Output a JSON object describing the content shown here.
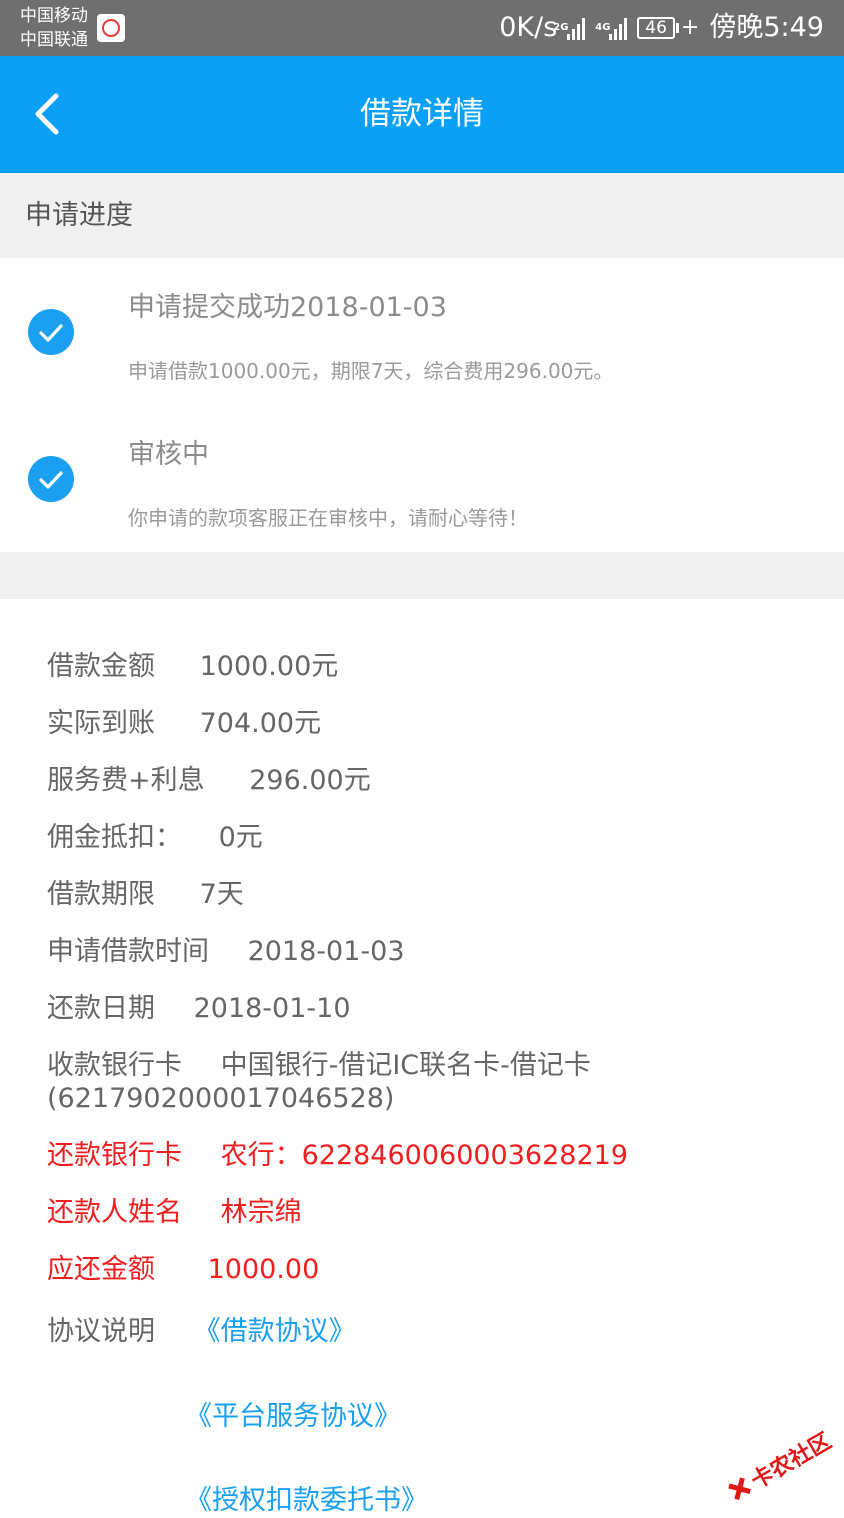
{
  "status_bar": {
    "carrier1": "中国移动",
    "carrier2": "中国联通",
    "speed": "0K/s",
    "net1": "2G",
    "net2": "4G",
    "battery": "46",
    "time": "傍晚5:49"
  },
  "header": {
    "title": "借款详情",
    "back_icon": "chevron-left-icon"
  },
  "progress": {
    "section_title": "申请进度",
    "steps": [
      {
        "title": "申请提交成功2018-01-03",
        "desc": "申请借款1000.00元，期限7天，综合费用296.00元。"
      },
      {
        "title": "审核中",
        "desc": "你申请的款项客服正在审核中，请耐心等待！"
      }
    ]
  },
  "details": {
    "loan_amount": {
      "label": "借款金额",
      "value": "1000.00元"
    },
    "actual_received": {
      "label": "实际到账",
      "value": "704.00元"
    },
    "fee_interest": {
      "label": "服务费+利息",
      "value": "296.00元"
    },
    "commission": {
      "label": "佣金抵扣：",
      "value": "0元"
    },
    "term": {
      "label": "借款期限",
      "value": "7天"
    },
    "apply_time": {
      "label": "申请借款时间",
      "value": "2018-01-03"
    },
    "repay_date": {
      "label": "还款日期",
      "value": "2018-01-10"
    },
    "receive_card": {
      "label": "收款银行卡",
      "value": "中国银行-借记IC联名卡-借记卡",
      "value2": "(6217902000017046528)"
    },
    "repay_card": {
      "label": "还款银行卡",
      "value": "农行：6228460060003628219"
    },
    "repayer_name": {
      "label": "还款人姓名",
      "value": "林宗绵"
    },
    "due_amount": {
      "label": "应还金额",
      "value": "1000.00"
    },
    "agreements": {
      "label": "协议说明",
      "links": [
        "《借款协议》",
        "《平台服务协议》",
        "《授权扣款委托书》"
      ]
    }
  },
  "colors": {
    "header_bg": "#0aa0f5",
    "check_bg": "#1a9ff1",
    "highlight_red": "#f01e1e",
    "link_blue": "#1a9ff1"
  },
  "watermark": {
    "text": "卡农社区"
  }
}
